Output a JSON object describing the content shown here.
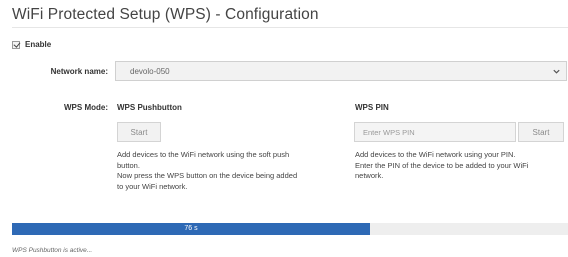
{
  "page": {
    "title": "WiFi Protected Setup (WPS) - Configuration"
  },
  "enable": {
    "label": "Enable",
    "checked": true
  },
  "network": {
    "label": "Network name:",
    "value": "devolo-050",
    "icon": "chevron-down-icon"
  },
  "wps_mode": {
    "label": "WPS Mode:"
  },
  "pushbutton": {
    "heading": "WPS Pushbutton",
    "button_label": "Start",
    "description_lines": [
      "Add devices to the WiFi network using the soft push",
      "button.",
      "Now press the WPS button on the device being added",
      "to your WiFi network."
    ]
  },
  "pin": {
    "heading": "WPS PIN",
    "input_placeholder": "Enter WPS PIN",
    "button_label": "Start",
    "description_lines": [
      "Add devices to the WiFi network using your PIN.",
      "Enter the PIN of the device to be added to your WiFi",
      "network."
    ]
  },
  "progress": {
    "label": "76 s",
    "fraction": 0.644,
    "fill_color": "#2e69b5",
    "track_color": "#eeeeee"
  },
  "status": {
    "text": "WPS Pushbutton is active..."
  }
}
